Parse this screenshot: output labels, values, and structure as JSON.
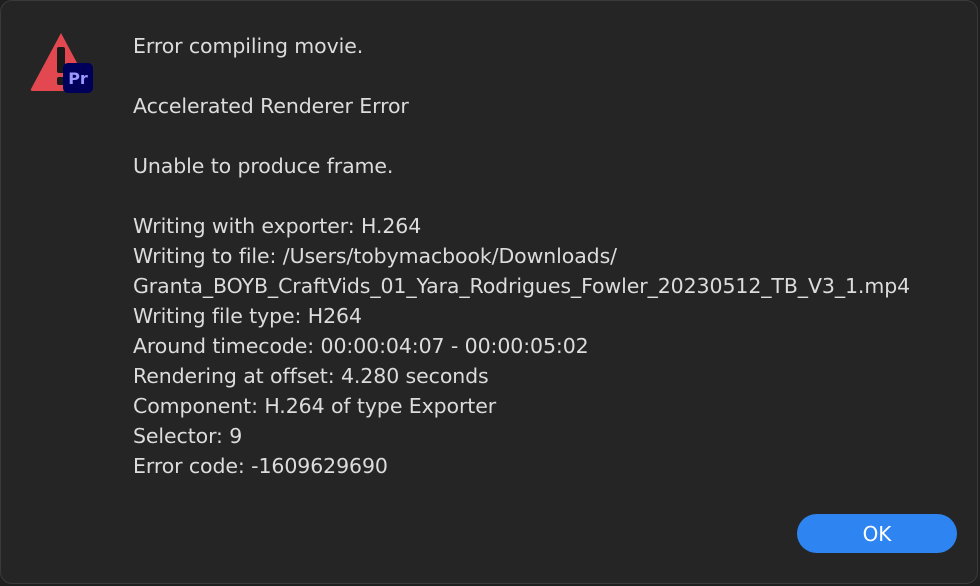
{
  "dialog": {
    "icon": {
      "name": "warning-triangle-icon",
      "badge_text": "Pr",
      "triangle_color": "#e34850",
      "badge_color": "#00005b",
      "badge_text_color": "#9999ff"
    },
    "title": "Error compiling movie.",
    "subtitle": "Accelerated Renderer Error",
    "message": "Unable to produce frame.",
    "details": [
      "Writing with exporter: H.264",
      "Writing to file: /Users/tobymacbook/Downloads/",
      "Granta_BOYB_CraftVids_01_Yara_Rodrigues_Fowler_20230512_TB_V3_1.mp4",
      "Writing file type: H264",
      "Around timecode: 00:00:04:07 - 00:00:05:02",
      "Rendering at offset: 4.280 seconds",
      "Component: H.264 of type Exporter",
      "Selector: 9",
      "Error code: -1609629690"
    ],
    "ok_label": "OK",
    "accent_color": "#2e84f0"
  }
}
